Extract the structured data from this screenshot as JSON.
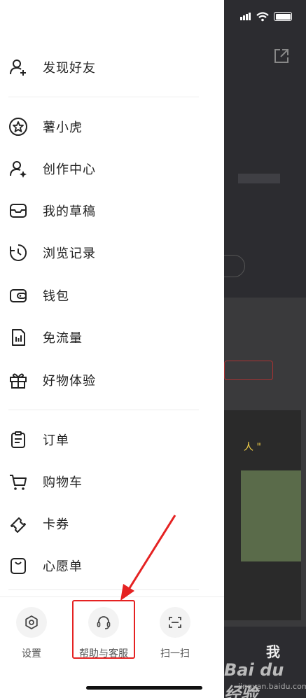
{
  "menu": {
    "group1": [
      {
        "label": "发现好友",
        "icon": "add-friend-icon"
      }
    ],
    "group2": [
      {
        "label": "薯小虎",
        "icon": "star-icon"
      },
      {
        "label": "创作中心",
        "icon": "creator-icon"
      },
      {
        "label": "我的草稿",
        "icon": "draft-box-icon"
      },
      {
        "label": "浏览记录",
        "icon": "history-clock-icon"
      },
      {
        "label": "钱包",
        "icon": "wallet-icon"
      },
      {
        "label": "免流量",
        "icon": "data-free-icon"
      },
      {
        "label": "好物体验",
        "icon": "gift-icon"
      }
    ],
    "group3": [
      {
        "label": "订单",
        "icon": "clipboard-icon"
      },
      {
        "label": "购物车",
        "icon": "cart-icon"
      },
      {
        "label": "卡券",
        "icon": "coupon-icon"
      },
      {
        "label": "心愿单",
        "icon": "wishlist-bag-icon"
      }
    ]
  },
  "bottom_bar": {
    "settings_label": "设置",
    "help_label": "帮助与客服",
    "scan_label": "扫一扫"
  },
  "background": {
    "tab_me_label": "我",
    "watermark": "Bai du 经验",
    "watermark_url": "jingyan.baidu.com",
    "photo_caption": "人 \""
  },
  "colors": {
    "annotation_red": "#e52222",
    "drawer_bg": "#ffffff",
    "overlay_bg": "#2c2c30"
  }
}
